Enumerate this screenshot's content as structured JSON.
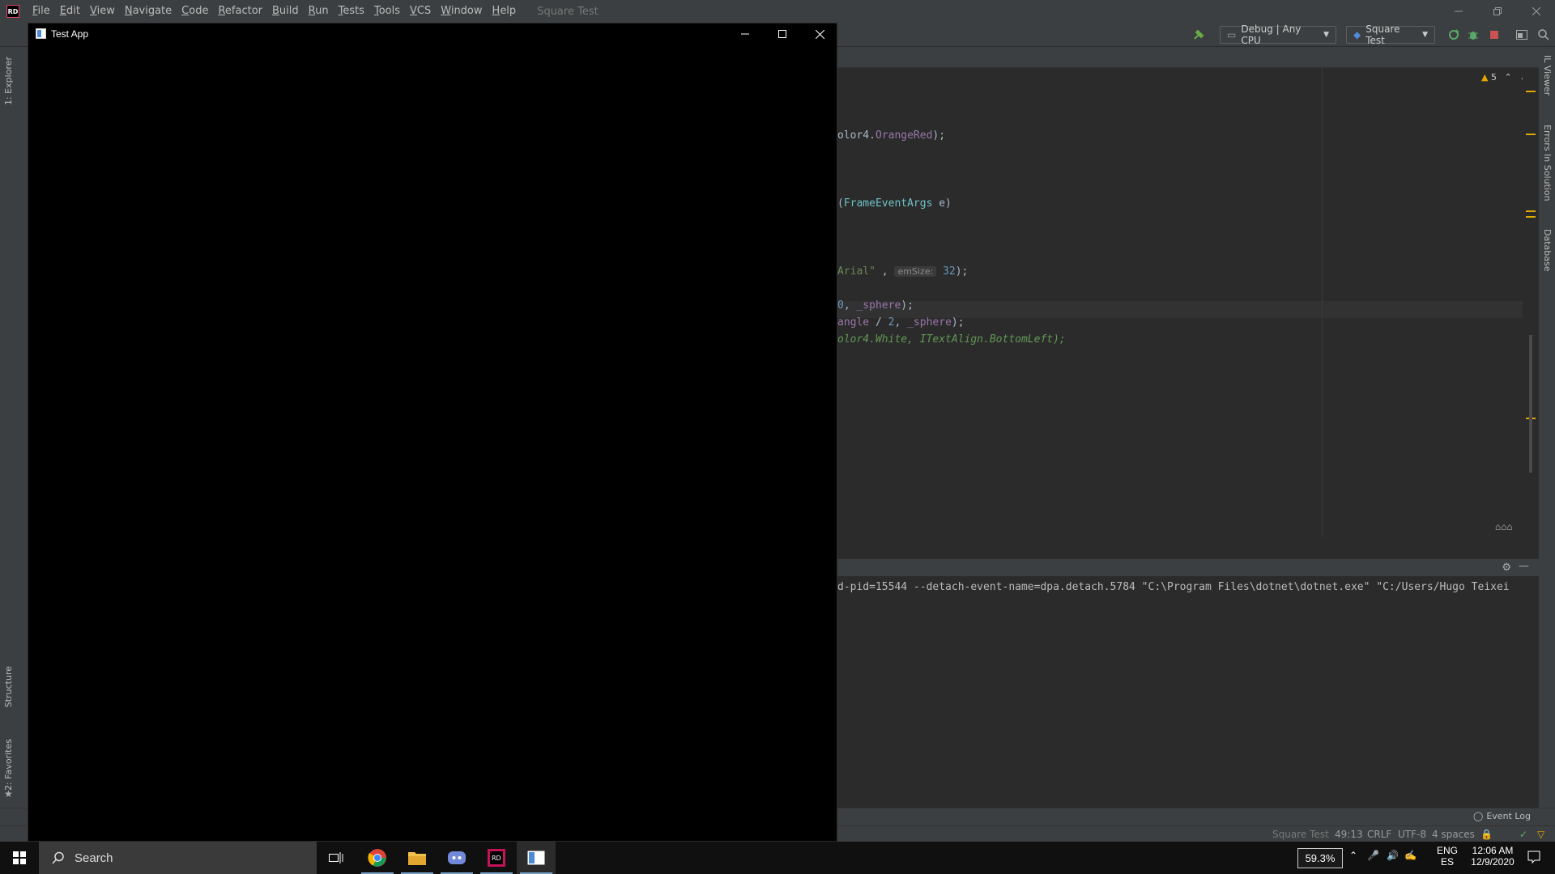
{
  "ide": {
    "menu": [
      "File",
      "Edit",
      "View",
      "Navigate",
      "Code",
      "Refactor",
      "Build",
      "Run",
      "Tests",
      "Tools",
      "VCS",
      "Window",
      "Help"
    ],
    "project_title": "Square Test",
    "logo_text": "RD",
    "config": "Debug | Any CPU",
    "run_config": "Square Test",
    "warnings_count": "5"
  },
  "editor": {
    "lines": [
      {
        "frag": [
          [
            "",
            "olor4."
          ],
          [
            "fld",
            "OrangeRed"
          ],
          [
            "",
            ");"
          ]
        ]
      },
      {
        "frag": [
          [
            "",
            "("
          ],
          [
            "typ",
            "FrameEventArgs"
          ],
          [
            "",
            " e)"
          ]
        ]
      },
      {
        "frag": [
          [
            "str",
            "Arial\""
          ],
          [
            "",
            " , "
          ],
          [
            "hint",
            "emSize:"
          ],
          [
            "",
            " "
          ],
          [
            "num",
            "32"
          ],
          [
            "",
            ");"
          ]
        ]
      },
      {
        "frag": [
          [
            "num",
            "0"
          ],
          [
            "",
            ", "
          ],
          [
            "fld",
            "_sphere"
          ],
          [
            "",
            ");"
          ]
        ]
      },
      {
        "frag": [
          [
            "fld",
            "angle"
          ],
          [
            "",
            " / "
          ],
          [
            "num",
            "2"
          ],
          [
            "",
            ", "
          ],
          [
            "fld",
            "_sphere"
          ],
          [
            "",
            ");"
          ]
        ]
      },
      {
        "frag": [
          [
            "cmt",
            "olor4.White, ITextAlign.BottomLeft);"
          ]
        ]
      }
    ]
  },
  "console": {
    "line": "d-pid=15544 --detach-event-name=dpa.detach.5784 \"C:\\Program Files\\dotnet\\dotnet.exe\" \"C:/Users/Hugo Teixei"
  },
  "left_tools": {
    "explorer": "1: Explorer",
    "structure": "Structure",
    "favorites": "2: Favorites"
  },
  "right_tools": {
    "il_viewer": "IL Viewer",
    "errors": "Errors In Solution",
    "database": "Database"
  },
  "event_log": "Event Log",
  "status": {
    "project": "Square Test",
    "position": "49:13",
    "line_sep": "CRLF",
    "encoding": "UTF-8",
    "indent": "4 spaces"
  },
  "test_app": {
    "title": "Test App"
  },
  "taskbar": {
    "search_placeholder": "Search",
    "zoom": "59.3%",
    "lang1": "ENG",
    "lang2": "ES",
    "time": "12:06 AM",
    "date": "12/9/2020"
  }
}
